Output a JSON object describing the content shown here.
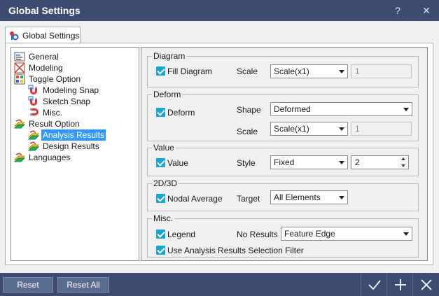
{
  "window": {
    "title": "Global Settings",
    "help_glyph": "?",
    "close_glyph": "✕"
  },
  "tab": {
    "label": "Global Settings"
  },
  "tree": {
    "items": [
      {
        "label": "General",
        "icon": "general-settings-icon"
      },
      {
        "label": "Modeling",
        "icon": "modeling-icon"
      },
      {
        "label": "Toggle Option",
        "icon": "toggle-option-icon"
      },
      {
        "label": "Modeling Snap",
        "icon": "magnet-snap-icon"
      },
      {
        "label": "Sketch Snap",
        "icon": "magnet-snap-icon"
      },
      {
        "label": "Misc.",
        "icon": "magnet-icon"
      },
      {
        "label": "Result Option",
        "icon": "result-option-icon"
      },
      {
        "label": "Analysis Results",
        "icon": "analysis-results-icon",
        "selected": true
      },
      {
        "label": "Design Results",
        "icon": "design-results-icon"
      },
      {
        "label": "Languages",
        "icon": "languages-icon"
      }
    ]
  },
  "groups": {
    "diagram": {
      "title": "Diagram",
      "fill_label": "Fill Diagram",
      "fill_checked": true,
      "scale_label": "Scale",
      "scale_value": "Scale(x1)",
      "scale_factor": "1"
    },
    "deform": {
      "title": "Deform",
      "deform_label": "Deform",
      "deform_checked": true,
      "shape_label": "Shape",
      "shape_value": "Deformed",
      "scale_label": "Scale",
      "scale_value": "Scale(x1)",
      "scale_factor": "1"
    },
    "value": {
      "title": "Value",
      "value_label": "Value",
      "value_checked": true,
      "style_label": "Style",
      "style_value": "Fixed",
      "decimals": "2"
    },
    "dim": {
      "title": "2D/3D",
      "nodal_label": "Nodal Average",
      "nodal_checked": true,
      "target_label": "Target",
      "target_value": "All Elements"
    },
    "misc": {
      "title": "Misc.",
      "legend_label": "Legend",
      "legend_checked": true,
      "no_results_label": "No Results",
      "no_results_value": "Feature Edge",
      "filter_label": "Use Analysis Results Selection Filter",
      "filter_checked": true
    }
  },
  "footer": {
    "reset_label": "Reset",
    "reset_all_label": "Reset All"
  },
  "colors": {
    "titlebar": "#3d4b70",
    "checkbox": "#18a6cf",
    "selection": "#3399ff"
  }
}
